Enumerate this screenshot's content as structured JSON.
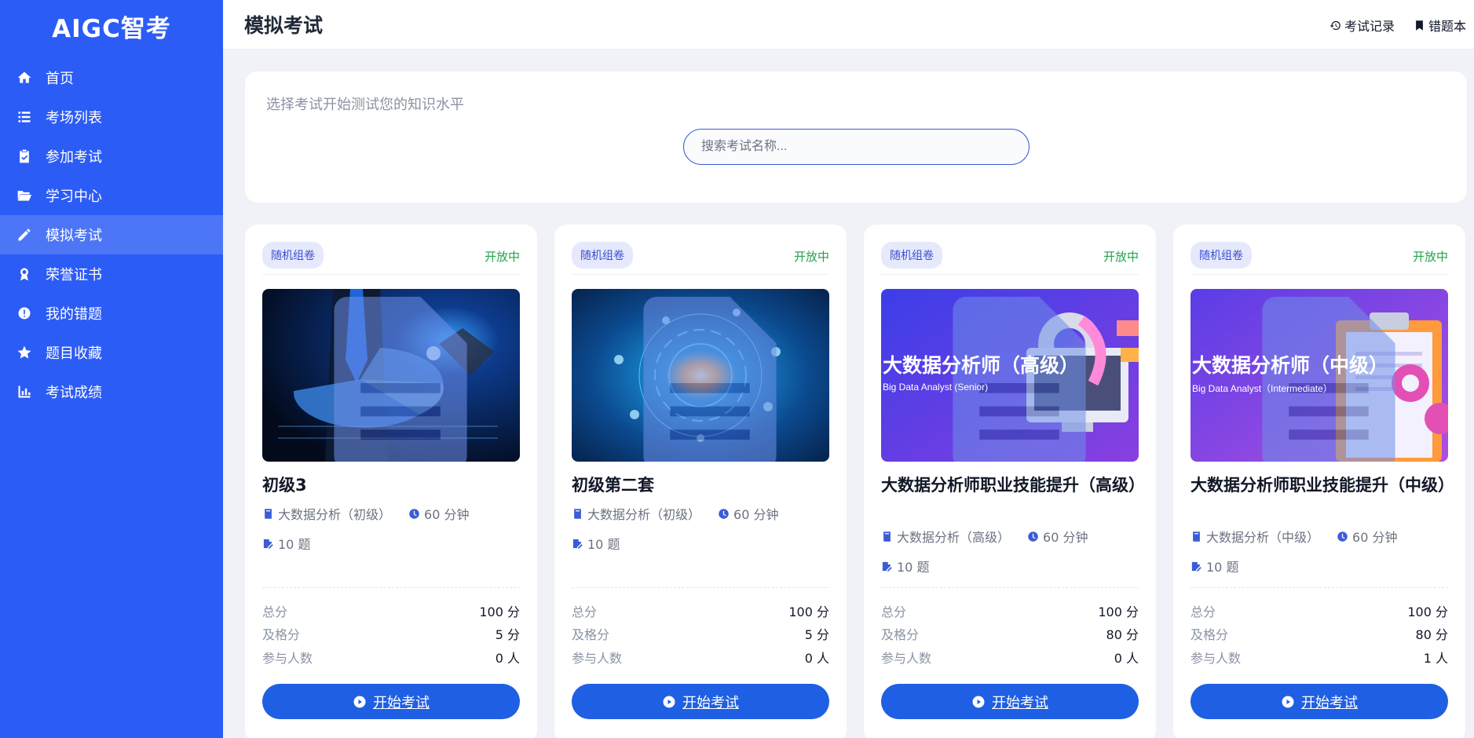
{
  "app": {
    "logo": "AIGC智考"
  },
  "sidebar": {
    "items": [
      {
        "label": "首页",
        "icon": "home-icon"
      },
      {
        "label": "考场列表",
        "icon": "list-icon"
      },
      {
        "label": "参加考试",
        "icon": "clipboard-icon"
      },
      {
        "label": "学习中心",
        "icon": "folder-open-icon"
      },
      {
        "label": "模拟考试",
        "icon": "pencil-icon",
        "active": true
      },
      {
        "label": "荣誉证书",
        "icon": "award-icon"
      },
      {
        "label": "我的错题",
        "icon": "alert-circle-icon"
      },
      {
        "label": "题目收藏",
        "icon": "star-icon"
      },
      {
        "label": "考试成绩",
        "icon": "bar-chart-icon"
      }
    ]
  },
  "header": {
    "title": "模拟考试",
    "records_label": "考试记录",
    "wrong_book_label": "错题本"
  },
  "search": {
    "subtitle": "选择考试开始测试您的知识水平",
    "placeholder": "搜索考试名称..."
  },
  "colors": {
    "sidebar": "#2c5cf6",
    "primary_button": "#1f5fe3",
    "status_open": "#22a34a"
  },
  "stat_labels": {
    "total": "总分",
    "pass": "及格分",
    "participants": "参与人数"
  },
  "cards": [
    {
      "tag": "随机组卷",
      "status": "开放中",
      "name": "初级3",
      "category": "大数据分析（初级）",
      "duration": "60 分钟",
      "questions": "10 题",
      "total": "100 分",
      "pass": "5 分",
      "participants": "0 人",
      "button": "开始考试"
    },
    {
      "tag": "随机组卷",
      "status": "开放中",
      "name": "初级第二套",
      "category": "大数据分析（初级）",
      "duration": "60 分钟",
      "questions": "10 题",
      "total": "100 分",
      "pass": "5 分",
      "participants": "0 人",
      "button": "开始考试"
    },
    {
      "tag": "随机组卷",
      "status": "开放中",
      "name": "大数据分析师职业技能提升（高级）",
      "category": "大数据分析（高级）",
      "duration": "60 分钟",
      "questions": "10 题",
      "total": "100 分",
      "pass": "80 分",
      "participants": "0 人",
      "button": "开始考试",
      "image_title": "大数据分析师（高级）",
      "image_subtitle": "Big Data Analyst (Senior)"
    },
    {
      "tag": "随机组卷",
      "status": "开放中",
      "name": "大数据分析师职业技能提升（中级）",
      "category": "大数据分析（中级）",
      "duration": "60 分钟",
      "questions": "10 题",
      "total": "100 分",
      "pass": "80 分",
      "participants": "1 人",
      "button": "开始考试",
      "image_title": "大数据分析师（中级）",
      "image_subtitle": "Big Data Analyst（Intermediate）"
    }
  ]
}
